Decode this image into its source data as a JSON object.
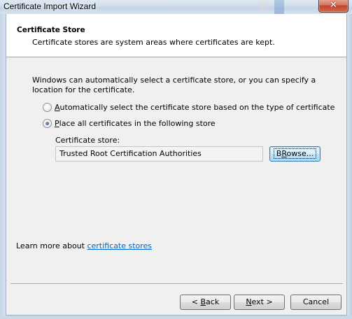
{
  "window": {
    "title": "Certificate Import Wizard",
    "close_glyph": "✕"
  },
  "header": {
    "title": "Certificate Store",
    "description": "Certificate stores are system areas where certificates are kept."
  },
  "body": {
    "intro": "Windows can automatically select a certificate store, or you can specify a location for the certificate.",
    "options": [
      {
        "mnemonic": "A",
        "rest": "utomatically select the certificate store based on the type of certificate",
        "checked": false
      },
      {
        "mnemonic": "P",
        "rest": "lace all certificates in the following store",
        "checked": true
      }
    ],
    "store_label": "Certificate store:",
    "store_value": "Trusted Root Certification Authorities",
    "browse": {
      "mnemonic": "R",
      "before": "B",
      "after": "owse..."
    }
  },
  "learn_more": {
    "prefix": "Learn more about ",
    "link": "certificate stores"
  },
  "footer": {
    "back": {
      "before": "< ",
      "mnemonic": "B",
      "after": "ack"
    },
    "next": {
      "mnemonic": "N",
      "after": "ext >"
    },
    "cancel": "Cancel"
  },
  "colors": {
    "link": "#0066cc",
    "close_button": "#c1452b",
    "focus_border": "#3c7fb1"
  }
}
